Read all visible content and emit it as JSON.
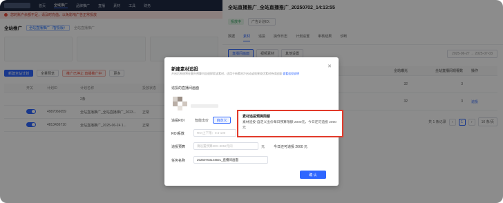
{
  "left": {
    "nav_items": [
      "首页",
      "全域推广",
      "品牌推广",
      "直播",
      "素材",
      "工具",
      "财务"
    ],
    "warning": "您的账户余额不足，请及时充值，以免影响广告正常投放",
    "title": "全站推广",
    "tag": "全站直播推广（智投版）",
    "subtag": "全站直播推广",
    "actions": {
      "new_plan": "新建全站计划",
      "batch": "全量预览",
      "alert": "推广已停止 直播推广中",
      "more": "更多"
    },
    "table": {
      "headers": [
        "开关",
        "计划ID",
        "计划名称",
        "投放状态"
      ],
      "rows": [
        {
          "id": "",
          "name": "2条",
          "status": ""
        },
        {
          "id": "4987066059",
          "name": "全站直播推广_全站直播推广_2023...",
          "status": "正常"
        },
        {
          "id": "4813436710",
          "name": "全站直播推广_2025-06-24 1...",
          "status": "正常"
        }
      ]
    }
  },
  "drawer": {
    "title": "全站直播推广_全站直播推广_20250702_14:13:55",
    "status_badge": "投放中",
    "plan_id_label": "广告计划ID：",
    "tabs": [
      "数据",
      "素材",
      "追投",
      "操作日志",
      "计划设置",
      "审核结果",
      "诊断"
    ],
    "active_tab": "素材",
    "subtabs": [
      "直播间画面",
      "视频素材",
      "其他设置"
    ],
    "date_start": "2025-06-27",
    "date_sep": "→",
    "date_end": "2025-07-03",
    "table": {
      "headers": [
        "",
        "全站曝光",
        "全站直播间观看数",
        "操作"
      ],
      "rows": [
        {
          "exposure": "32",
          "views": "3",
          "op": ""
        },
        {
          "exposure": "32",
          "views": "3",
          "op": "追投"
        }
      ]
    },
    "pager": {
      "total": "共 1 条记录",
      "page": "1",
      "size": "10 条/页"
    }
  },
  "modal": {
    "title": "新建素材追投",
    "subtitle": "开启后系统将在额外预算内加速探索该素材，适用于新素材冷启动或效果较优素材持续放量",
    "subtitle_link": "查看追投说明",
    "section": "追投的直播间画面",
    "roi_label": "追投ROI",
    "roi_option_smart": "智能出价",
    "roi_option_custom": "自定义",
    "roi_coef_label": "ROI系数",
    "roi_placeholder": "ROI上下限：0.5-100",
    "budget_label": "追投预算",
    "budget_placeholder": "请设置预算300~3052元间",
    "budget_unit": "元",
    "budget_today": "今日还可追投 2000 元",
    "task_label": "任务名称",
    "task_value": "20250703144501_直播间画面",
    "confirm": "确 认"
  },
  "tooltip": {
    "title": "素材追投预算限额",
    "body": "素材追投-自定义出价每日预算限额 2000元，今日还可追投 2000元"
  }
}
